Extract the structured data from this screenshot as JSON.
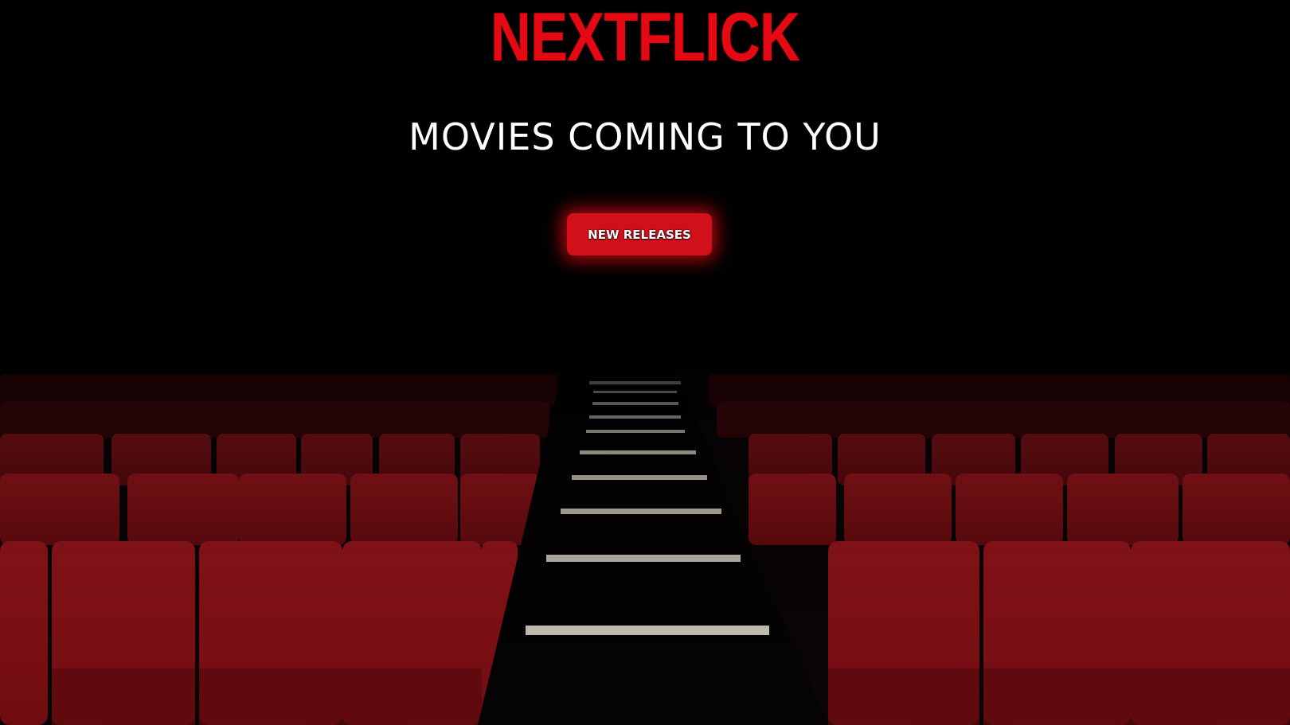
{
  "brand": {
    "logo_text": "NEXTFLICK",
    "accent_color": "#e50914"
  },
  "hero": {
    "headline": "MOVIES COMING TO YOU",
    "cta_label": "NEW RELEASES",
    "background_image": "theater-seats-background"
  }
}
